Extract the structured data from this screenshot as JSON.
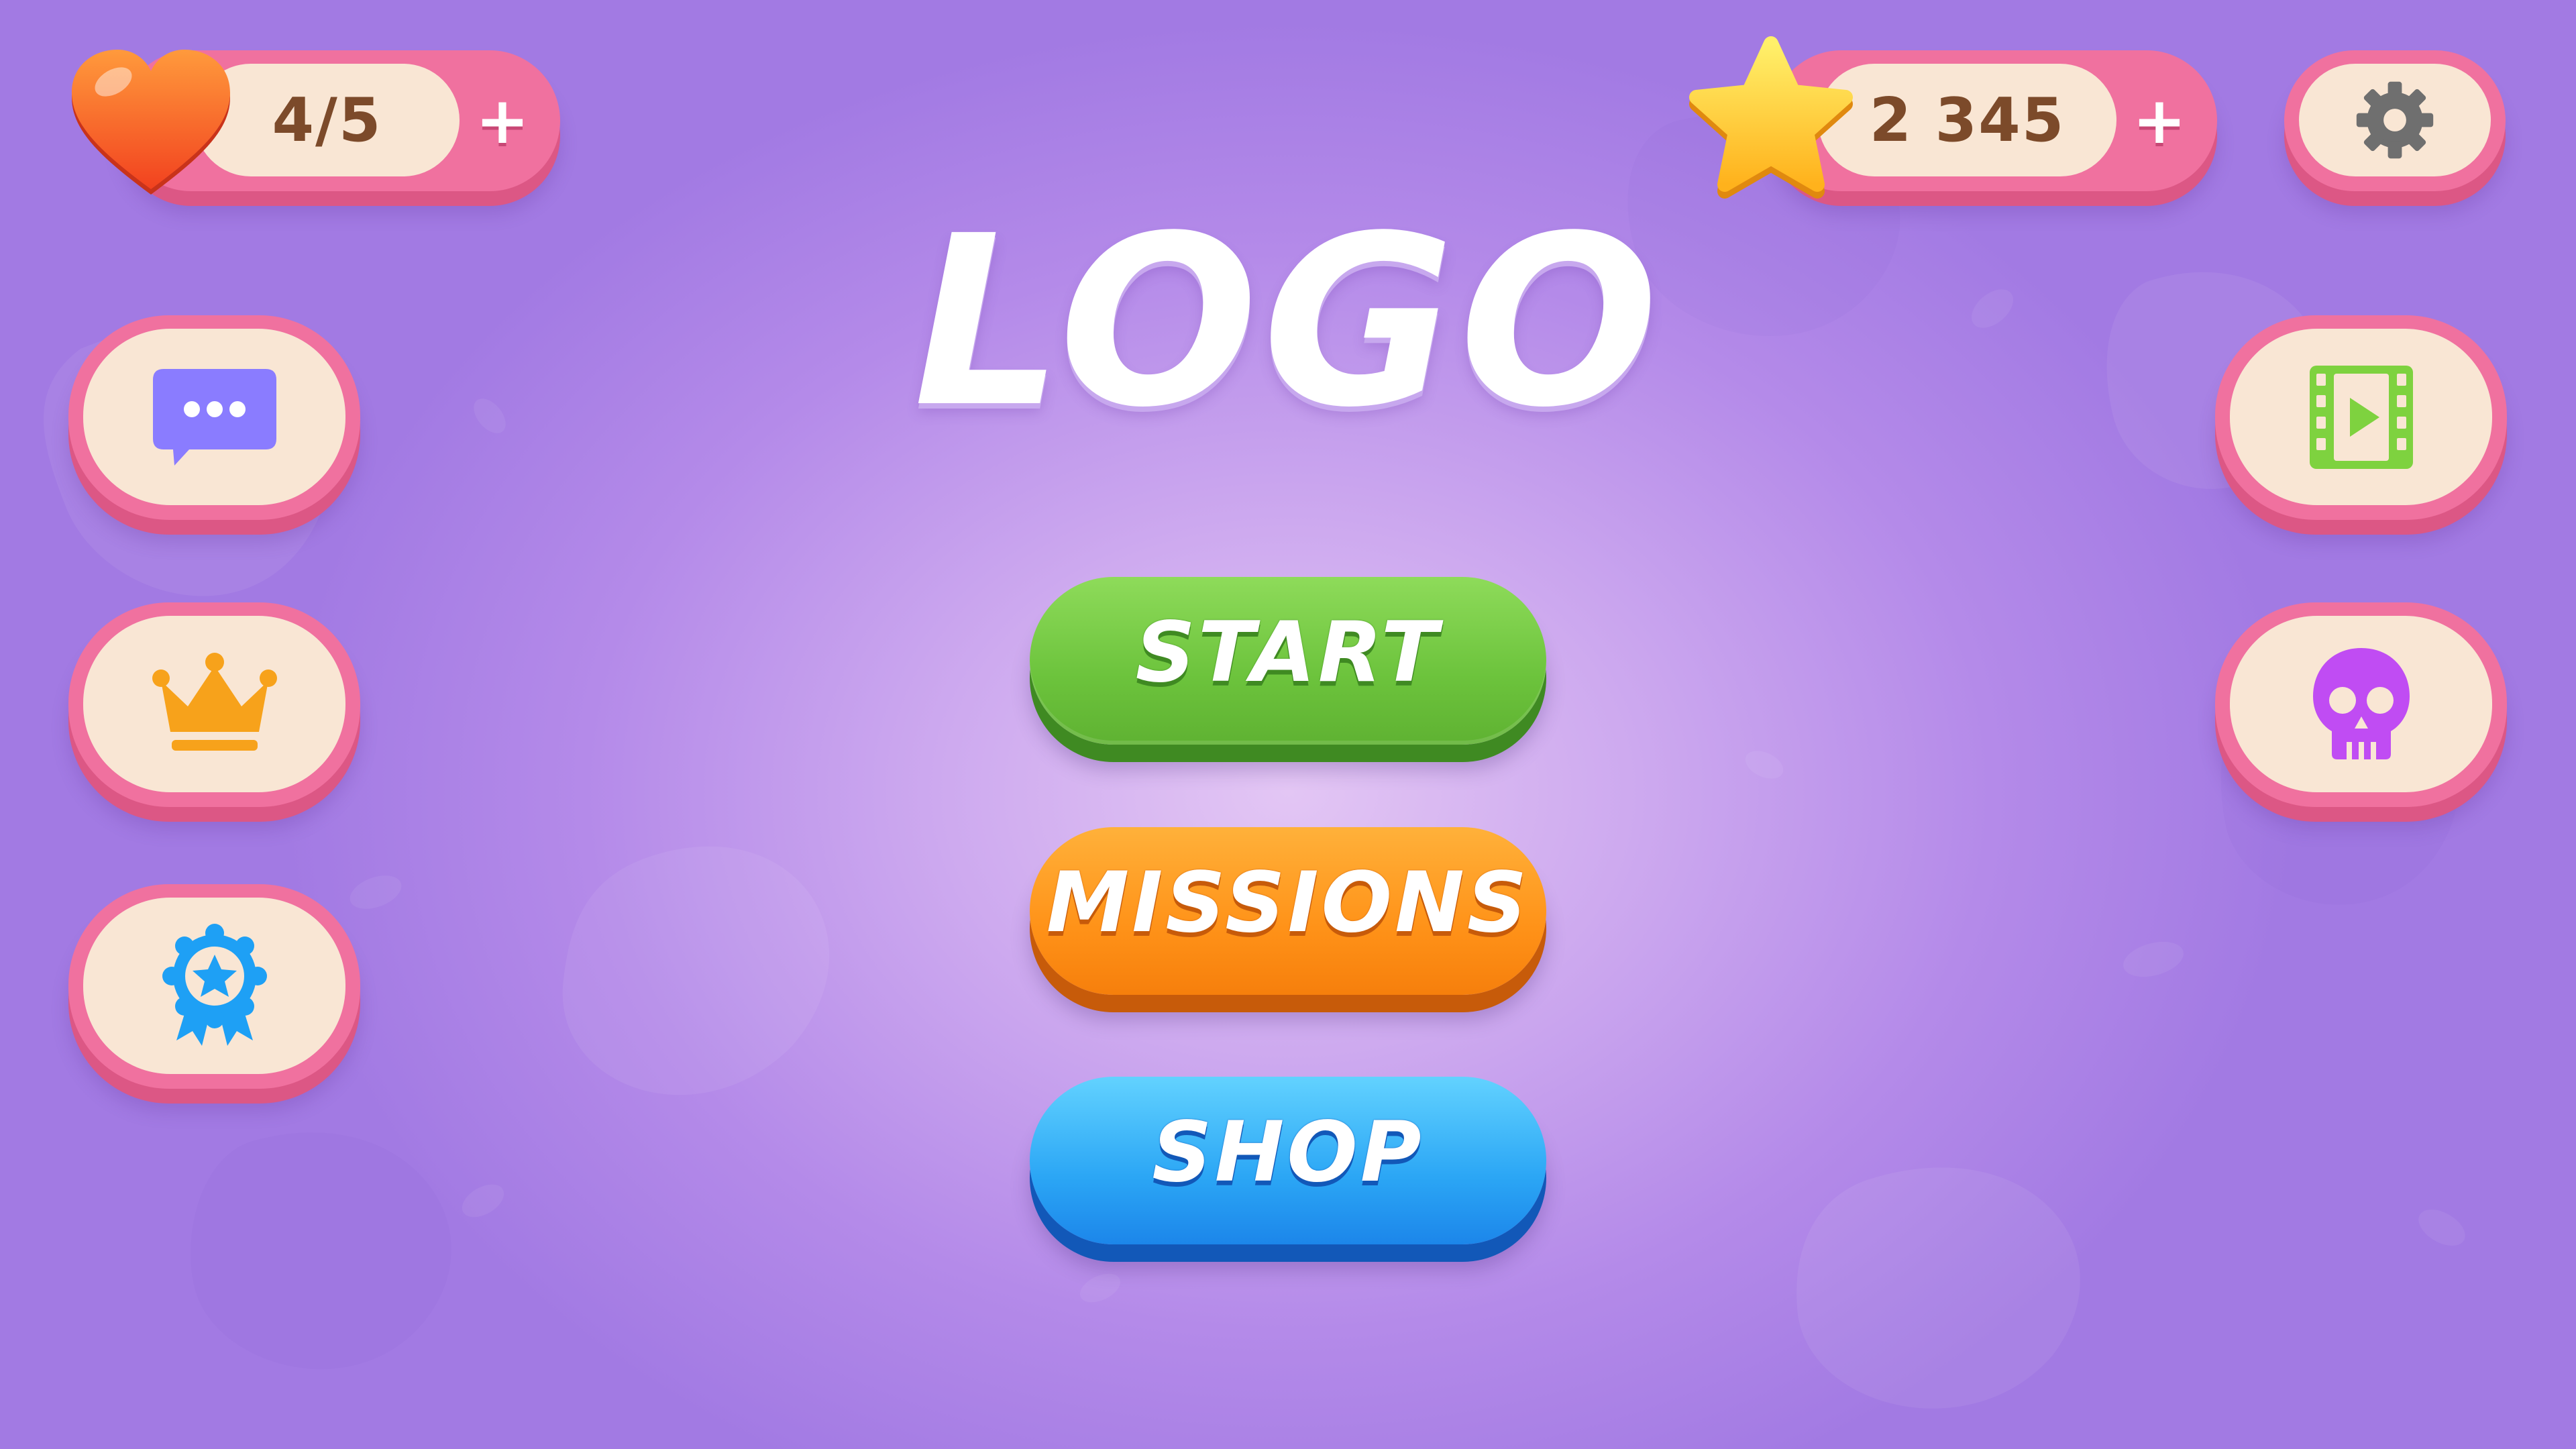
{
  "hud": {
    "lives": {
      "value": "4/5",
      "plus_label": "+",
      "icon": "heart-icon",
      "icon_color": "#ff6a2b"
    },
    "stars": {
      "value": "2 345",
      "plus_label": "+",
      "icon": "star-icon",
      "icon_color": "#ffc62b"
    },
    "settings": {
      "icon": "gear-icon",
      "icon_color": "#6f6f6f"
    }
  },
  "logo": {
    "text": "LOGO"
  },
  "menu": {
    "buttons": [
      {
        "label": "START",
        "color": "#6cc33c"
      },
      {
        "label": "MISSIONS",
        "color": "#ff9218"
      },
      {
        "label": "SHOP",
        "color": "#2ba6f5"
      }
    ]
  },
  "left_sidebar": {
    "items": [
      {
        "icon": "chat-bubble-icon",
        "icon_color": "#8a7cff"
      },
      {
        "icon": "crown-icon",
        "icon_color": "#f7a21b"
      },
      {
        "icon": "award-badge-icon",
        "icon_color": "#1ea0f5"
      }
    ]
  },
  "right_sidebar": {
    "items": [
      {
        "icon": "video-film-icon",
        "icon_color": "#7ed23f"
      },
      {
        "icon": "skull-icon",
        "icon_color": "#c04cf3"
      }
    ]
  },
  "theme": {
    "background": "#b48ae9",
    "pill_border": "#f0719f",
    "pill_fill": "#f9e6d4",
    "counter_text": "#7c4a2a"
  }
}
